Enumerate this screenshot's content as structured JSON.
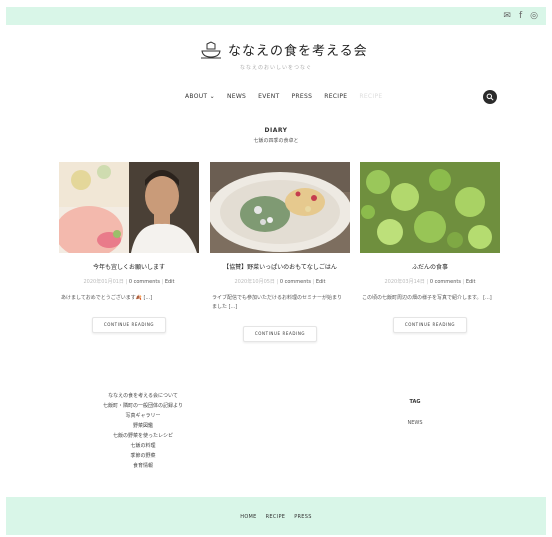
{
  "topbar": {
    "social_icons": [
      "mail-icon",
      "facebook-icon",
      "instagram-icon"
    ],
    "social_glyphs": [
      "✉",
      "f",
      "◎"
    ]
  },
  "header": {
    "site_title": "ななえの食を考える会",
    "tagline": "ななえのおいしいをつなぐ",
    "nav": [
      "ABOUT ⌄",
      "NEWS",
      "EVENT",
      "PRESS",
      "RECIPE",
      "RECIPE"
    ]
  },
  "section": {
    "title": "DIARY",
    "subtitle": "七飯の四季の食卓と"
  },
  "posts": [
    {
      "title": "今年も宜しくお願いします",
      "date": "2020年01月01日",
      "comments": "0 comments",
      "edit": "Edit",
      "excerpt": "あけましておめでとうございます🍂 [...]",
      "button": "CONTINUE READING"
    },
    {
      "title": "【協賛】野菜いっぱいのおもてなしごはん",
      "date": "2020年10月05日",
      "comments": "0 comments",
      "edit": "Edit",
      "excerpt": "ライブ配信でも参加いただけるお料理のセミナーが始まりました [...]",
      "button": "CONTINUE READING"
    },
    {
      "title": "ふだんの食事",
      "date": "2020年03月14日",
      "comments": "0 comments",
      "edit": "Edit",
      "excerpt": "この頃の七飯町周辺の畑の様子を写真で紹介します。 [...]",
      "button": "CONTINUE READING"
    }
  ],
  "footer_links": [
    "ななえの食を考える会について",
    "七飯町・隣町の一般団体の記録より",
    "写真ギャラリー",
    "野菜図鑑",
    "七飯の野菜を使ったレシピ",
    "七飯の料理",
    "季節の野菜",
    "食育情報"
  ],
  "tag": {
    "title": "TAG",
    "items": [
      "NEWS"
    ]
  },
  "bottom_nav": [
    "HOME",
    "RECIPE",
    "PRESS"
  ],
  "colors": {
    "band": "#d9f6e8",
    "search_button": "#2b2b2b"
  }
}
